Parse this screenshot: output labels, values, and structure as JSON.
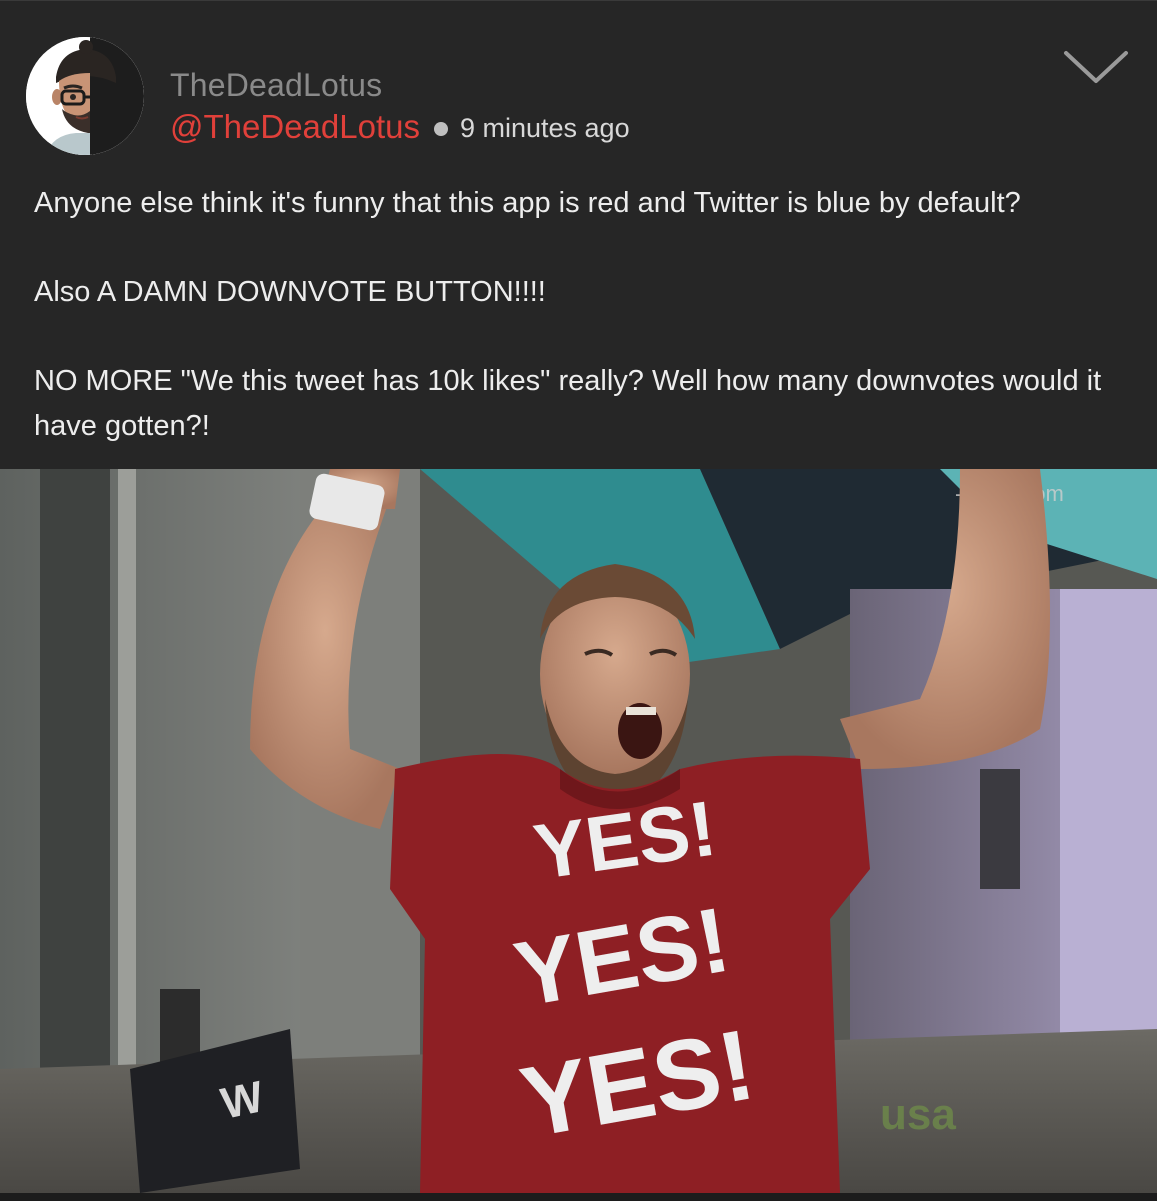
{
  "post": {
    "display_name": "TheDeadLotus",
    "handle": "@TheDeadLotus",
    "timestamp": "9 minutes ago",
    "paragraphs": [
      "Anyone else think it's funny that this app is red and Twitter is blue by default?",
      "Also A DAMN DOWNVOTE BUTTON!!!!",
      "NO MORE \"We this tweet has 10k likes\" really? Well how many downvotes would it have gotten?!"
    ],
    "menu_icon": "chevron-down-icon"
  },
  "media": {
    "shirt_lines": [
      "YES!",
      "YES!",
      "YES!"
    ],
    "watermark": "-finder.com",
    "network_logo": "usa"
  },
  "colors": {
    "background": "#262626",
    "handle": "#e0403a",
    "display_name": "#8a8a8a",
    "body_text": "#ededed",
    "shirt": "#8e1f24"
  }
}
